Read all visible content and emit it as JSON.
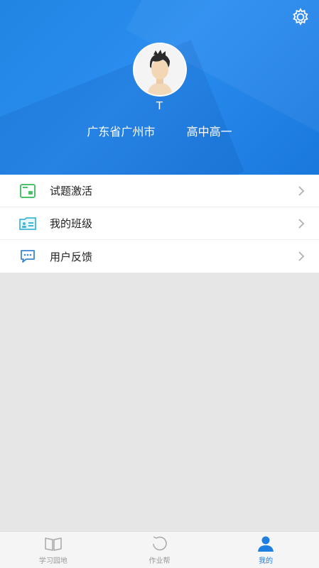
{
  "header": {
    "username": "T",
    "location": "广东省广州市",
    "grade": "高中高一"
  },
  "menu": {
    "items": [
      {
        "label": "试题激活",
        "icon": "ticket-icon"
      },
      {
        "label": "我的班级",
        "icon": "class-card-icon"
      },
      {
        "label": "用户反馈",
        "icon": "chat-bubble-icon"
      }
    ]
  },
  "tabs": [
    {
      "label": "学习园地",
      "icon": "book-icon",
      "active": false
    },
    {
      "label": "作业帮",
      "icon": "circle-icon",
      "active": false
    },
    {
      "label": "我的",
      "icon": "person-icon",
      "active": true
    }
  ],
  "colors": {
    "header_blue": "#1f86e3",
    "accent_blue": "#1f7fe0",
    "ticket_green": "#4cc36a",
    "class_teal": "#3fb7d8",
    "feedback_blue": "#3a86d0"
  }
}
